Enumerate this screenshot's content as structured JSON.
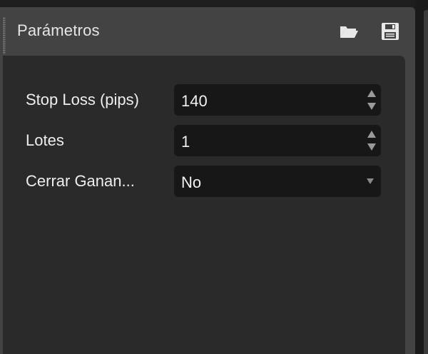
{
  "panel": {
    "title": "Parámetros",
    "header_icons": [
      "open-folder-icon",
      "save-icon"
    ]
  },
  "parameters": [
    {
      "label": "Stop Loss (pips)",
      "value": "140",
      "control": "spinner"
    },
    {
      "label": "Lotes",
      "value": "1",
      "control": "spinner"
    },
    {
      "label": "Cerrar Ganan...",
      "value": "No",
      "control": "dropdown"
    }
  ],
  "colors": {
    "panel_bg": "#434343",
    "content_bg": "#2a2a2a",
    "field_bg": "#171717",
    "text": "#eeeeee"
  }
}
